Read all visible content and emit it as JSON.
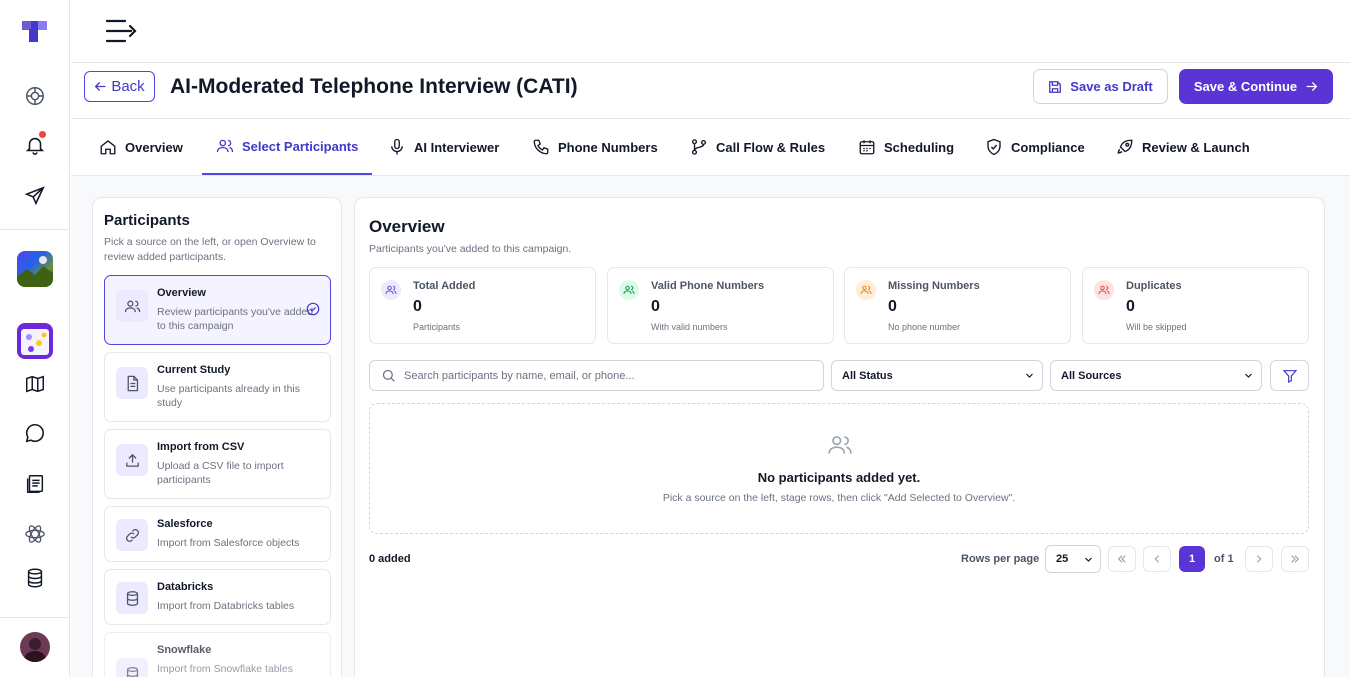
{
  "header": {
    "back_label": "Back",
    "title": "AI-Moderated Telephone Interview (CATI)",
    "save_draft_label": "Save as Draft",
    "save_continue_label": "Save & Continue"
  },
  "tabs": [
    {
      "label": "Overview",
      "icon": "home-icon"
    },
    {
      "label": "Select Participants",
      "icon": "users-icon",
      "active": true
    },
    {
      "label": "AI Interviewer",
      "icon": "microphone-icon"
    },
    {
      "label": "Phone Numbers",
      "icon": "phone-icon"
    },
    {
      "label": "Call Flow & Rules",
      "icon": "git-branch-icon"
    },
    {
      "label": "Scheduling",
      "icon": "calendar-icon"
    },
    {
      "label": "Compliance",
      "icon": "shield-check-icon"
    },
    {
      "label": "Review & Launch",
      "icon": "rocket-icon"
    }
  ],
  "sources": {
    "title": "Participants",
    "description": "Pick a source on the left, or open Overview to review added participants.",
    "items": [
      {
        "name": "Overview",
        "desc": "Review participants you've added to this campaign",
        "icon": "users-icon",
        "active": true
      },
      {
        "name": "Current Study",
        "desc": "Use participants already in this study",
        "icon": "document-icon"
      },
      {
        "name": "Import from CSV",
        "desc": "Upload a CSV file to import participants",
        "icon": "upload-icon"
      },
      {
        "name": "Salesforce",
        "desc": "Import from Salesforce objects",
        "icon": "link-icon"
      },
      {
        "name": "Databricks",
        "desc": "Import from Databricks tables",
        "icon": "database-icon"
      },
      {
        "name": "Snowflake",
        "desc": "Import from Snowflake tables",
        "icon": "database-icon"
      }
    ]
  },
  "overview": {
    "title": "Overview",
    "subtitle": "Participants you've added to this campaign.",
    "stats": [
      {
        "label": "Total Added",
        "value": "0",
        "note": "Participants",
        "color": "#6d5bd0"
      },
      {
        "label": "Valid Phone Numbers",
        "value": "0",
        "note": "With valid numbers",
        "color": "#16a34a"
      },
      {
        "label": "Missing Numbers",
        "value": "0",
        "note": "No phone number",
        "color": "#ea8a1a"
      },
      {
        "label": "Duplicates",
        "value": "0",
        "note": "Will be skipped",
        "color": "#e0525f"
      }
    ],
    "search_placeholder": "Search participants by name, email, or phone...",
    "status_filter": "All Status",
    "source_filter": "All Sources",
    "empty_title": "No participants added yet.",
    "empty_sub": "Pick a source on the left, stage rows, then click \"Add Selected to Overview\".",
    "added_count": "0 added",
    "rows_per_page_label": "Rows per page",
    "rows_per_page": "25",
    "current_page": "1",
    "page_of": "of 1"
  },
  "colors": {
    "accent": "#5b34d6",
    "accent_text": "#4338ca",
    "notification": "#ef4444"
  }
}
